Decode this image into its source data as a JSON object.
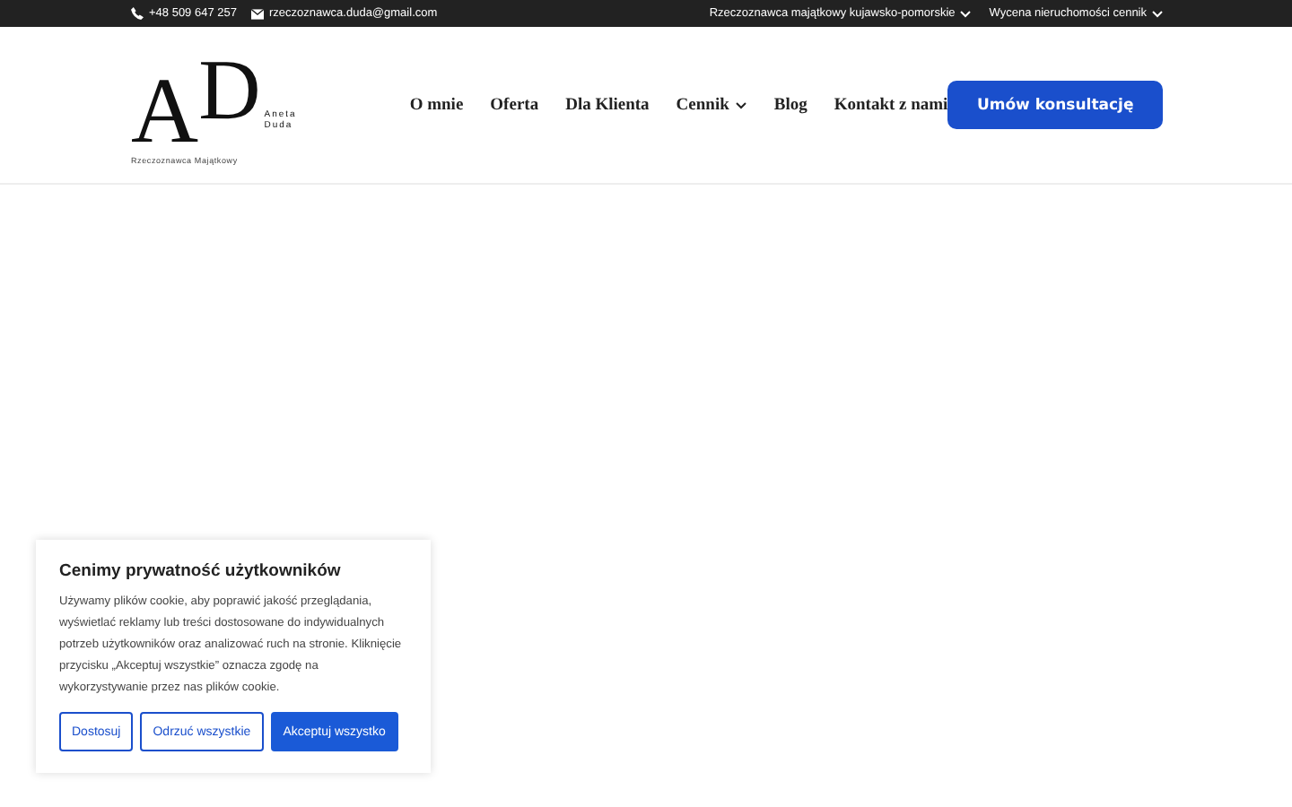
{
  "top_bar": {
    "phone": "+48 509 647 257",
    "email": "rzeczoznawca.duda@gmail.com",
    "links": [
      {
        "label": "Rzeczoznawca majątkowy kujawsko-pomorskie",
        "has_submenu": true
      },
      {
        "label": "Wycena nieruchomości cennik",
        "has_submenu": true
      }
    ]
  },
  "logo": {
    "letter_1": "A",
    "letter_2": "D",
    "name_1": "Aneta",
    "name_2": "Duda",
    "tagline": "Rzeczoznawca Majątkowy"
  },
  "nav": [
    {
      "label": "O mnie",
      "has_submenu": false
    },
    {
      "label": "Oferta",
      "has_submenu": false
    },
    {
      "label": "Dla Klienta",
      "has_submenu": false
    },
    {
      "label": "Cennik",
      "has_submenu": true
    },
    {
      "label": "Blog",
      "has_submenu": false
    },
    {
      "label": "Kontakt z nami",
      "has_submenu": false
    }
  ],
  "cta_button": "Umów konsultację",
  "cookie_banner": {
    "title": "Cenimy prywatność użytkowników",
    "text": "Używamy plików cookie, aby poprawić jakość przeglądania, wyświetlać reklamy lub treści dostosowane do indywidualnych potrzeb użytkowników oraz analizować ruch na stronie. Kliknięcie przycisku „Akceptuj wszystkie” oznacza zgodę na wykorzystywanie przez nas plików cookie.",
    "buttons": [
      {
        "label": "Dostosuj",
        "kind": "outline"
      },
      {
        "label": "Odrzuć wszystkie",
        "kind": "outline"
      },
      {
        "label": "Akceptuj wszystko",
        "kind": "primary"
      }
    ]
  }
}
